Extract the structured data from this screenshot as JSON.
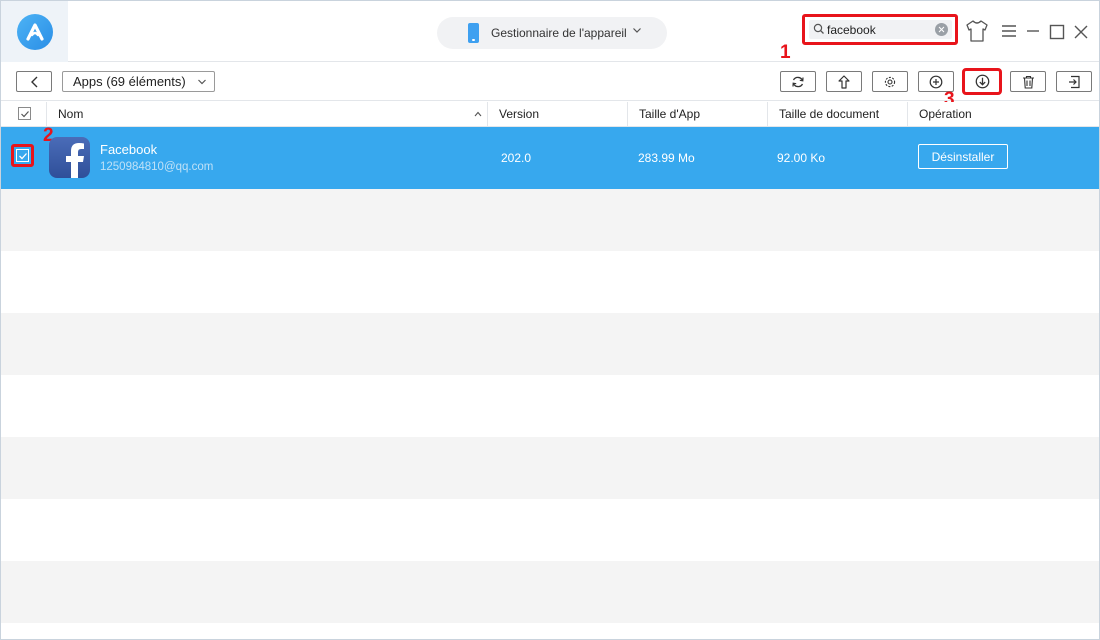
{
  "header": {
    "device_label": "Gestionnaire de l'appareil",
    "search": {
      "value": "facebook"
    }
  },
  "toolbar": {
    "category_label": "Apps (69 éléments)",
    "buttons": [
      "back-icon",
      "refresh-icon",
      "export-icon",
      "settings-icon",
      "add-icon",
      "download-icon",
      "trash-icon",
      "exit-icon"
    ]
  },
  "table": {
    "columns": [
      "Nom",
      "Version",
      "Taille d'App",
      "Taille de document",
      "Opération"
    ],
    "rows": [
      {
        "name": "Facebook",
        "account": "1250984810@qq.com",
        "version": "202.0",
        "app_size": "283.99 Mo",
        "doc_size": "92.00 Ko",
        "action": "Désinstaller"
      }
    ]
  },
  "annotations": [
    "1",
    "2",
    "3"
  ],
  "colors": {
    "accent": "#37a8ee",
    "highlight": "#e8141b",
    "row_alt": "#f4f4f4"
  }
}
